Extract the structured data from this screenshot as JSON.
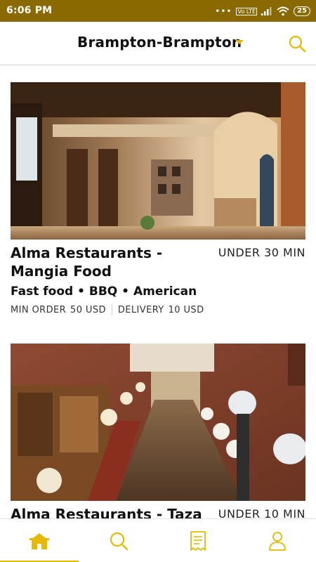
{
  "status_bar": {
    "time": "6:06 PM",
    "network": "Vo LTE",
    "battery": "25"
  },
  "header": {
    "location": "Brampton-Brampton",
    "dropdown_icon": "caret-down-icon",
    "search_icon": "search-icon"
  },
  "restaurants": [
    {
      "name": "Alma Restaurants -Mangia Food",
      "delivery_time": "UNDER 30 MIN",
      "cuisines": "Fast food • BBQ • American",
      "min_order_label": "MIN ORDER",
      "min_order_value": "50 USD",
      "delivery_label": "DELIVERY",
      "delivery_value": "10 USD"
    },
    {
      "name": "Alma Restaurants - Taza",
      "delivery_time": "UNDER 10 MIN"
    }
  ],
  "tab_bar": {
    "tabs": [
      {
        "icon": "home-icon",
        "active": true
      },
      {
        "icon": "search-icon",
        "active": false
      },
      {
        "icon": "receipt-icon",
        "active": false
      },
      {
        "icon": "profile-icon",
        "active": false
      }
    ],
    "accent_color": "#e6b800"
  },
  "colors": {
    "status_bar": "#8a6a00",
    "accent": "#e6b800"
  }
}
